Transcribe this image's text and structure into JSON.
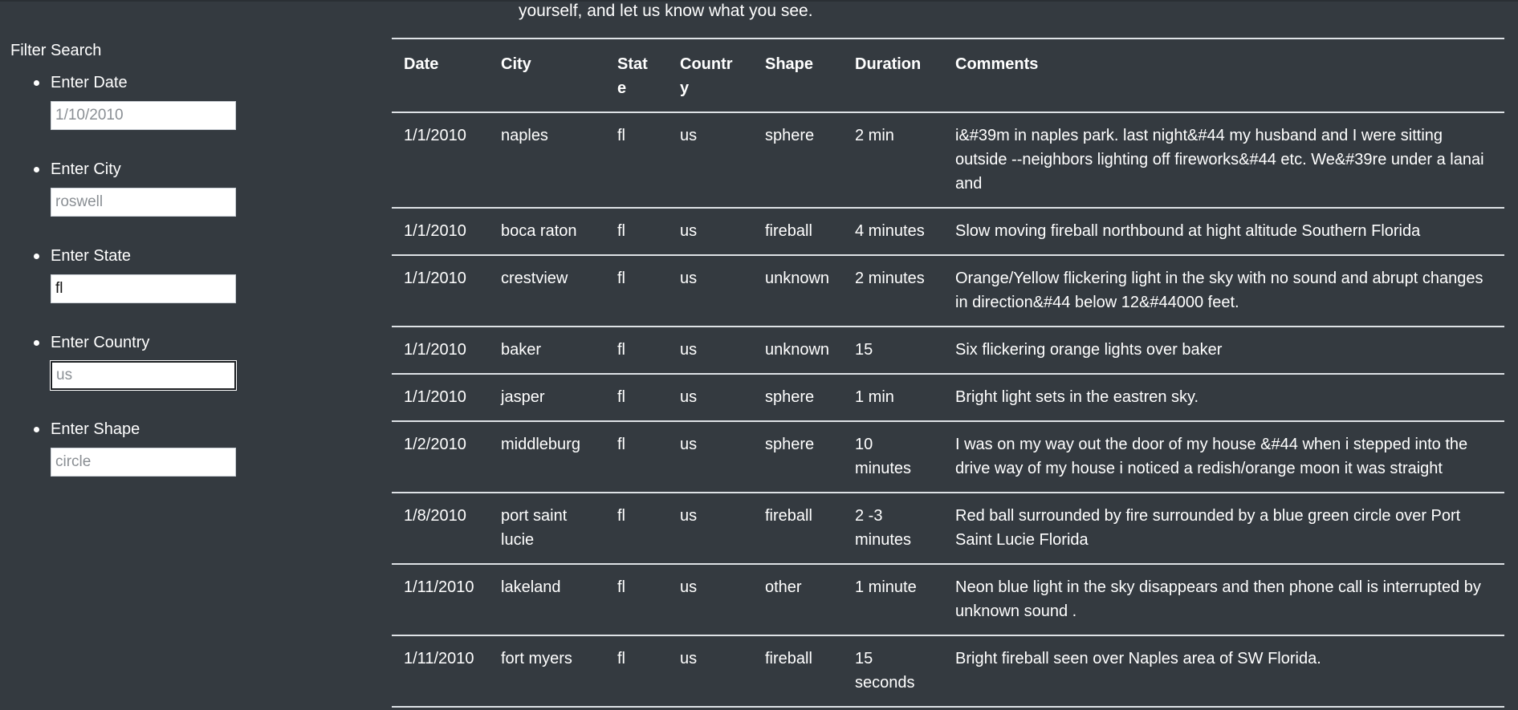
{
  "intro_text": "yourself, and let us know what you see.",
  "filters": {
    "title": "Filter Search",
    "items": [
      {
        "label": "Enter Date",
        "placeholder": "1/10/2010",
        "value": ""
      },
      {
        "label": "Enter City",
        "placeholder": "roswell",
        "value": ""
      },
      {
        "label": "Enter State",
        "placeholder": "",
        "value": "fl"
      },
      {
        "label": "Enter Country",
        "placeholder": "us",
        "value": ""
      },
      {
        "label": "Enter Shape",
        "placeholder": "circle",
        "value": ""
      }
    ]
  },
  "table": {
    "headers": [
      "Date",
      "City",
      "State",
      "Country",
      "Shape",
      "Duration",
      "Comments"
    ],
    "rows": [
      [
        "1/1/2010",
        "naples",
        "fl",
        "us",
        "sphere",
        "2 min",
        "i&#39m in naples park. last night&#44 my husband and I were sitting outside --neighbors lighting off fireworks&#44 etc. We&#39re under a lanai and"
      ],
      [
        "1/1/2010",
        "boca raton",
        "fl",
        "us",
        "fireball",
        "4 minutes",
        "Slow moving fireball northbound at hight altitude Southern Florida"
      ],
      [
        "1/1/2010",
        "crestview",
        "fl",
        "us",
        "unknown",
        "2 minutes",
        "Orange/Yellow flickering light in the sky with no sound and abrupt changes in direction&#44 below 12&#44000 feet."
      ],
      [
        "1/1/2010",
        "baker",
        "fl",
        "us",
        "unknown",
        "15",
        "Six flickering orange lights over baker"
      ],
      [
        "1/1/2010",
        "jasper",
        "fl",
        "us",
        "sphere",
        "1 min",
        "Bright light sets in the eastren sky."
      ],
      [
        "1/2/2010",
        "middleburg",
        "fl",
        "us",
        "sphere",
        "10 minutes",
        "I was on my way out the door of my house &#44 when i stepped into the drive way of my house i noticed a redish/orange moon it was straight"
      ],
      [
        "1/8/2010",
        "port saint lucie",
        "fl",
        "us",
        "fireball",
        "2 -3 minutes",
        "Red ball surrounded by fire surrounded by a blue green circle over Port Saint Lucie Florida"
      ],
      [
        "1/11/2010",
        "lakeland",
        "fl",
        "us",
        "other",
        "1 minute",
        "Neon blue light in the sky disappears and then phone call is interrupted by unknown sound ."
      ],
      [
        "1/11/2010",
        "fort myers",
        "fl",
        "us",
        "fireball",
        "15 seconds",
        "Bright fireball seen over Naples area of SW Florida."
      ]
    ]
  }
}
